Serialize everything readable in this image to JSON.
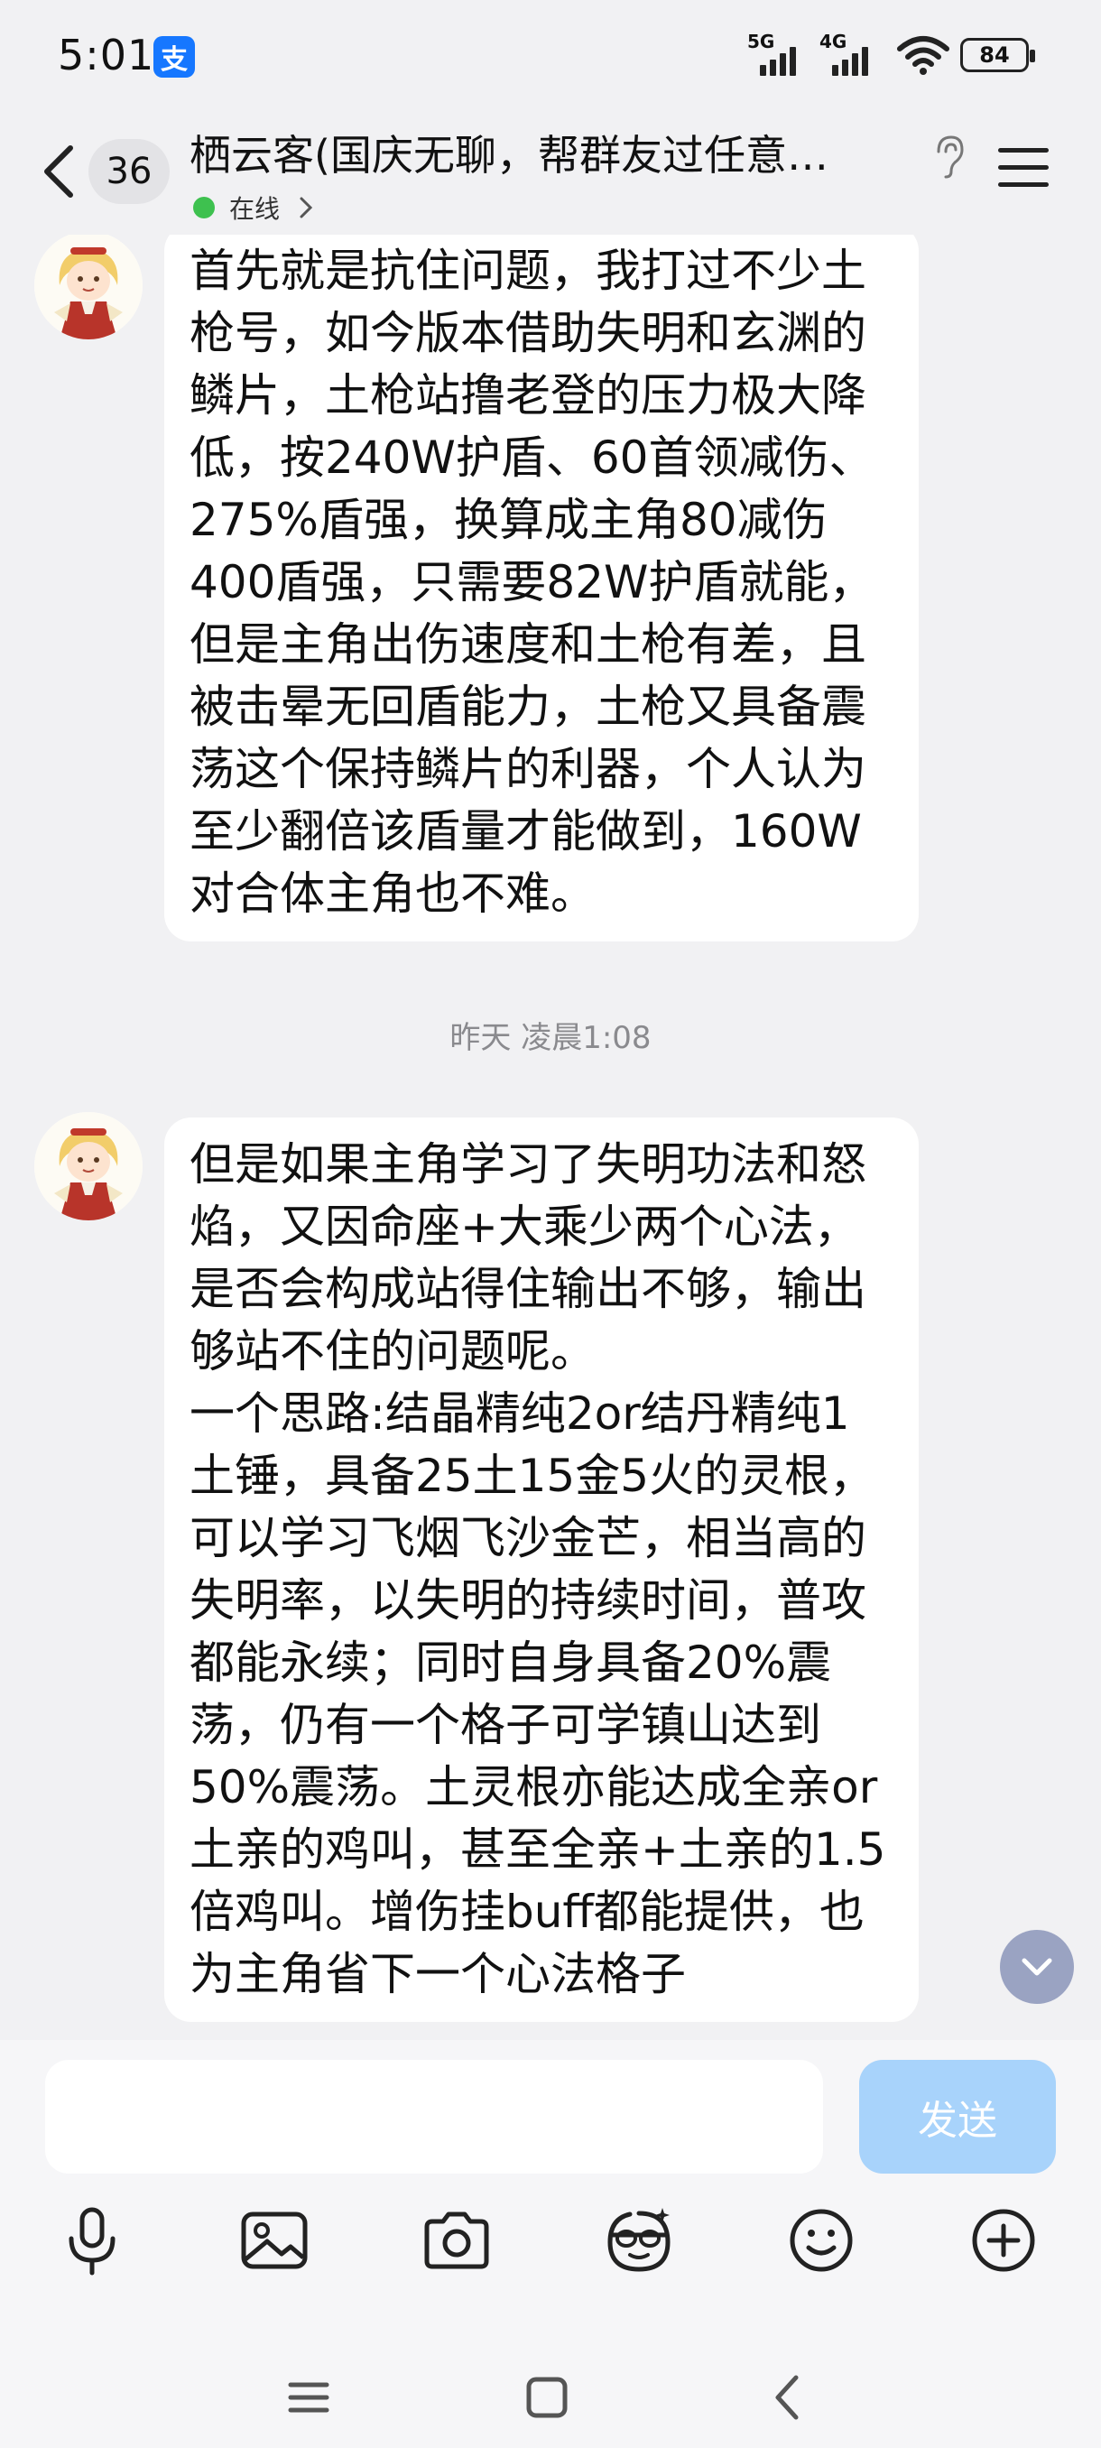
{
  "status_bar": {
    "time": "5:01",
    "app_badge": "支",
    "net1": "5G",
    "net2": "4G",
    "battery": "84"
  },
  "header": {
    "unread_count": "36",
    "title": "栖云客(国庆无聊，帮群友过任意…",
    "status": "在线"
  },
  "messages": [
    {
      "sender": "avatar",
      "text": "首先就是抗住问题，我打过不少土枪号，如今版本借助失明和玄渊的鳞片，土枪站撸老登的压力极大降低，按240W护盾、60首领减伤、275%盾强，换算成主角80减伤400盾强，只需要82W护盾就能，但是主角出伤速度和土枪有差，且被击晕无回盾能力，土枪又具备震荡这个保持鳞片的利器，个人认为至少翻倍该盾量才能做到，160W对合体主角也不难。"
    },
    {
      "sender": "avatar",
      "text": "但是如果主角学习了失明功法和怒焰，又因命座+大乘少两个心法，是否会构成站得住输出不够，输出够站不住的问题呢。\n一个思路:结晶精纯2or结丹精纯1土锤，具备25土15金5火的灵根，可以学习飞烟飞沙金芒，相当高的失明率，以失明的持续时间，普攻都能永续；同时自身具备20%震荡，仍有一个格子可学镇山达到50%震荡。土灵根亦能达成全亲or土亲的鸡叫，甚至全亲+土亲的1.5倍鸡叫。增伤挂buff都能提供，也为主角省下一个心法格子"
    }
  ],
  "timestamp": "昨天 凌晨1:08",
  "input": {
    "placeholder": "",
    "value": "",
    "send_label": "发送"
  },
  "toolbar": {
    "icons": [
      "mic-icon",
      "image-icon",
      "camera-icon",
      "sticker-face-icon",
      "emoji-icon",
      "plus-icon"
    ]
  },
  "colors": {
    "background": "#f1f1f3",
    "bubble": "#ffffff",
    "send_button": "#a8d3fb",
    "online": "#3ec14f"
  }
}
